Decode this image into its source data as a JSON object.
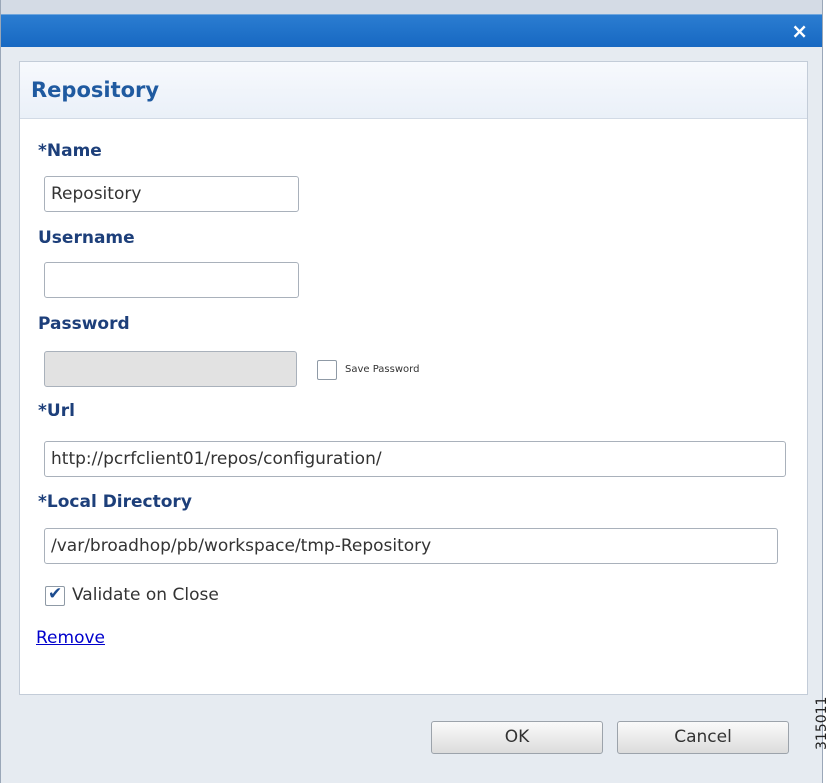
{
  "dialog": {
    "close_glyph": "×"
  },
  "panel": {
    "title": "Repository"
  },
  "form": {
    "name_label": "*Name",
    "name_value": "Repository",
    "username_label": "Username",
    "username_value": "",
    "password_label": "Password",
    "password_value": "",
    "save_password_label": "Save Password",
    "save_password_checked": false,
    "url_label": "*Url",
    "url_value": "http://pcrfclient01/repos/configuration/",
    "local_dir_label": "*Local Directory",
    "local_dir_value": "/var/broadhop/pb/workspace/tmp-Repository",
    "validate_label": "Validate on Close",
    "validate_checked": true,
    "validate_mark": "✔",
    "remove_link": "Remove"
  },
  "footer": {
    "ok_label": "OK",
    "cancel_label": "Cancel"
  },
  "figure_id": "315011",
  "colors": {
    "titlebar": "#1d6fc8",
    "label_text": "#1d3f7a",
    "title_text": "#1f5aa0",
    "link": "#0000cc"
  }
}
